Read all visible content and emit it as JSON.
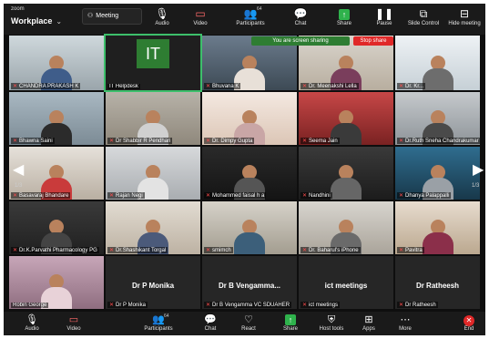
{
  "app": {
    "brand_small": "zoom",
    "brand_name": "Workplace"
  },
  "top_toolbar": {
    "meeting_label": "Meeting",
    "audio_label": "Audio",
    "video_label": "Video",
    "participants_label": "Participants",
    "participants_count": "64",
    "chat_label": "Chat",
    "share_label": "Share",
    "pause_label": "Pause",
    "slide_control_label": "Slide Control",
    "hide_meeting_label": "Hide meeting"
  },
  "share_banner": {
    "text": "You are screen sharing",
    "stop_label": "Stop share"
  },
  "pagination": {
    "left": "1/3",
    "right": "1/3"
  },
  "tiles": [
    {
      "name": "CHANDRA PRAKASH K",
      "center_text": ""
    },
    {
      "name": "IT Helpdesk",
      "center_text": "",
      "initials": "IT"
    },
    {
      "name": "Bhuvana K",
      "center_text": ""
    },
    {
      "name": "Dr. Meenakshi Lella",
      "center_text": ""
    },
    {
      "name": "Dr. Kr...",
      "center_text": ""
    },
    {
      "name": "Bhawna Saini",
      "center_text": ""
    },
    {
      "name": "Dr Shabbir R Pendhari",
      "center_text": ""
    },
    {
      "name": "Dr. Dimpy Gupta",
      "center_text": ""
    },
    {
      "name": "Seema Jain",
      "center_text": ""
    },
    {
      "name": "Dr.Ruth Sneha Chandrakumar",
      "center_text": ""
    },
    {
      "name": "Basavaraj Bhandare",
      "center_text": ""
    },
    {
      "name": "Rajan Negi",
      "center_text": ""
    },
    {
      "name": "Mohammed faisal h a",
      "center_text": ""
    },
    {
      "name": "Nandhini",
      "center_text": ""
    },
    {
      "name": "Dhanya Palappalli",
      "center_text": ""
    },
    {
      "name": "Dr.K.Parvathi Pharmacology PG",
      "center_text": ""
    },
    {
      "name": "Dr.Shashikant Torgal",
      "center_text": ""
    },
    {
      "name": "smimch",
      "center_text": ""
    },
    {
      "name": "Dr. Baharul's iPhone",
      "center_text": ""
    },
    {
      "name": "Pavitra",
      "center_text": ""
    },
    {
      "name": "Robin George",
      "center_text": ""
    },
    {
      "name": "Dr P Monika",
      "center_text": "Dr P Monika"
    },
    {
      "name": "Dr B Vengamma VC SDUAHER",
      "center_text": "Dr B Vengamma..."
    },
    {
      "name": "ict meetings",
      "center_text": "ict meetings"
    },
    {
      "name": "Dr Ratheesh",
      "center_text": "Dr Ratheesh"
    }
  ],
  "bottom_toolbar": {
    "audio_label": "Audio",
    "video_label": "Video",
    "participants_label": "Participants",
    "participants_count": "64",
    "chat_label": "Chat",
    "react_label": "React",
    "share_label": "Share",
    "host_tools_label": "Host tools",
    "apps_label": "Apps",
    "more_label": "More",
    "end_label": "End"
  },
  "colors": {
    "share_green": "#2e7d32",
    "stop_red": "#e02828",
    "active_border": "#3dbf6b",
    "mic_muted": "#ff4d4d"
  }
}
